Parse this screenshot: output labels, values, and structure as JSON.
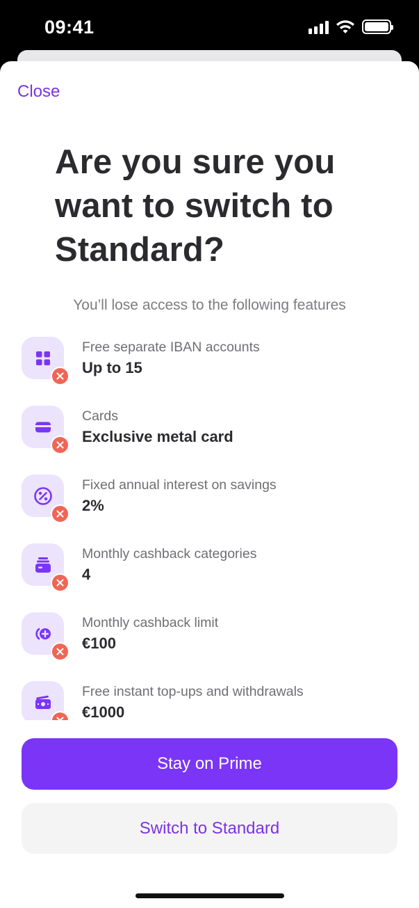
{
  "status_bar": {
    "time": "09:41",
    "icons": [
      "cellular-signal-icon",
      "wifi-icon",
      "battery-icon"
    ]
  },
  "sheet": {
    "close_label": "Close",
    "title": "Are you sure you want to switch to Standard?",
    "subtitle": "You’ll lose access to the following features"
  },
  "features": [
    {
      "icon": "grid-icon",
      "label": "Free separate IBAN accounts",
      "value": "Up to 15"
    },
    {
      "icon": "card-icon",
      "label": "Cards",
      "value": "Exclusive metal card"
    },
    {
      "icon": "percent-icon",
      "label": "Fixed annual interest on savings",
      "value": "2%"
    },
    {
      "icon": "cashback-categories-icon",
      "label": "Monthly cashback categories",
      "value": "4"
    },
    {
      "icon": "cashback-limit-icon",
      "label": "Monthly cashback limit",
      "value": "€100"
    },
    {
      "icon": "cash-icon",
      "label": "Free instant top-ups and withdrawals",
      "value": "€1000"
    }
  ],
  "buttons": {
    "primary": "Stay on Prime",
    "secondary": "Switch to Standard"
  },
  "colors": {
    "accent": "#7a35f7",
    "accent_text": "#7a33e6",
    "icon_bg": "#ece3fd",
    "badge": "#ef6656"
  }
}
